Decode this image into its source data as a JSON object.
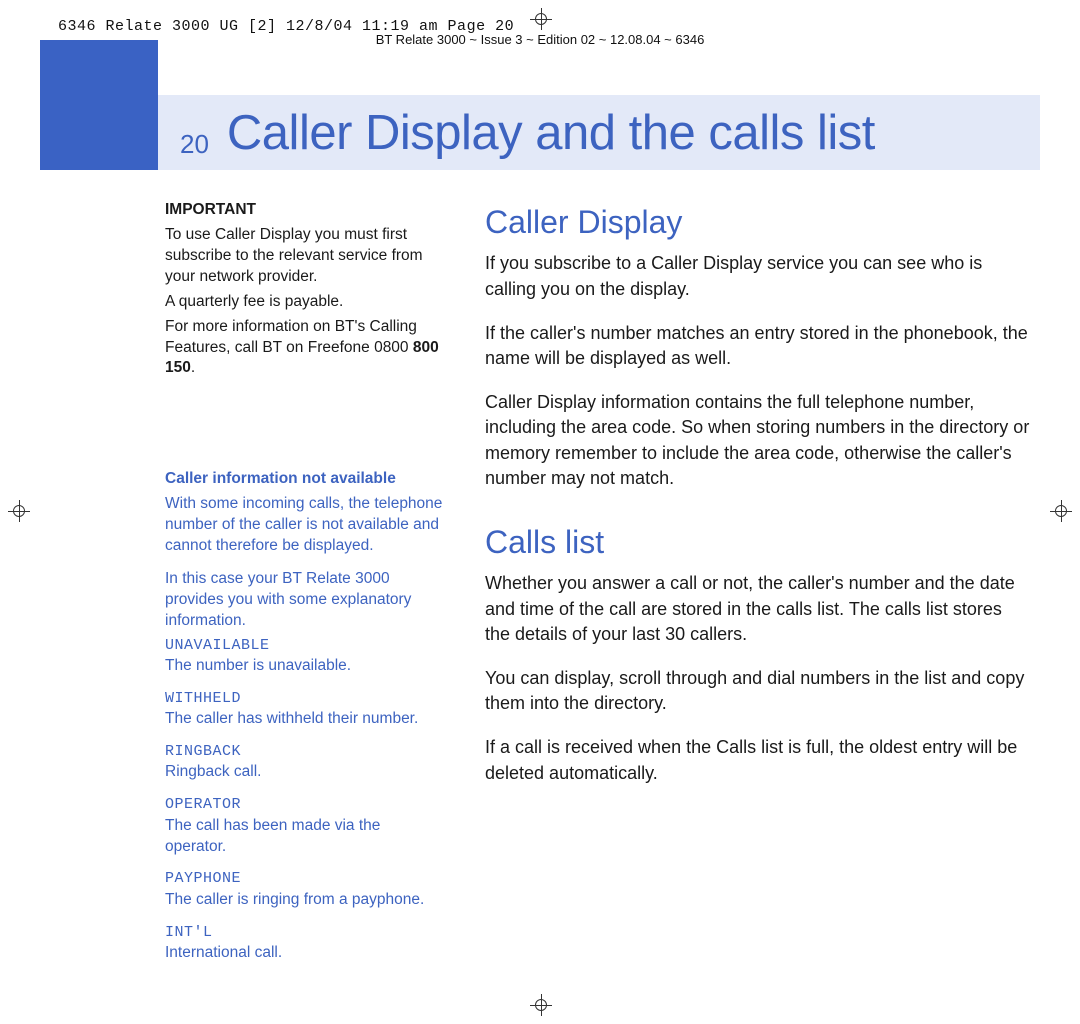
{
  "slug": "6346 Relate 3000 UG [2]  12/8/04  11:19 am  Page 20",
  "footer": "BT Relate 3000 ~ Issue 3 ~ Edition 02 ~ 12.08.04 ~ 6346",
  "page_number": "20",
  "chapter_title": "Caller Display and the calls list",
  "sidebar": {
    "important": {
      "heading": "IMPORTANT",
      "p1": "To use Caller Display you must first subscribe to the relevant service from your network provider.",
      "p2": "A quarterly fee is payable.",
      "p3a": "For more information on BT's Calling Features, call BT on Freefone 0800 ",
      "p3b": "800 150",
      "p3c": "."
    },
    "caller_info": {
      "heading": "Caller information not available",
      "p1": "With some incoming calls, the telephone number of the caller is not available and cannot therefore be displayed.",
      "p2": "In this case your BT Relate 3000 provides you with some explanatory information.",
      "items": [
        {
          "code": "UNAVAILABLE",
          "desc": "The number is unavailable."
        },
        {
          "code": "WITHHELD",
          "desc": "The caller has withheld their number."
        },
        {
          "code": "RINGBACK",
          "desc": "Ringback call."
        },
        {
          "code": "OPERATOR",
          "desc": "The call has been made via the operator."
        },
        {
          "code": "PAYPHONE",
          "desc": "The caller is ringing from a payphone."
        },
        {
          "code": "INT'L",
          "desc": "International call."
        }
      ]
    }
  },
  "main": {
    "s1": {
      "heading": "Caller Display",
      "p1": "If you subscribe to a Caller Display service you can see who is calling you on the display.",
      "p2": "If the caller's number matches an entry stored in the phonebook, the name will be displayed as well.",
      "p3": "Caller Display information contains the full telephone number, including the area code. So when storing numbers in the directory or memory remember to include the area code, otherwise the caller's number may not match."
    },
    "s2": {
      "heading": "Calls list",
      "p1": "Whether you answer a call or not, the caller's number and the date and time of the call are stored in the calls list. The calls list stores the details of your last 30 callers.",
      "p2": "You can display, scroll through and dial numbers in the list and copy them into the directory.",
      "p3": "If a call is received when the Calls list is full, the oldest entry will be deleted automatically."
    }
  }
}
